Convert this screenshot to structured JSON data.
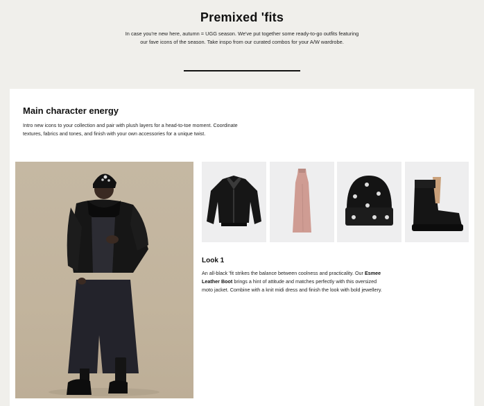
{
  "header": {
    "title": "Premixed 'fits",
    "intro": "In case you're new here, autumn = UGG season. We've put together some ready-to-go outfits featuring our fave icons of the season. Take inspo from our curated combos for your A/W wardrobe."
  },
  "section": {
    "title": "Main character energy",
    "intro": "Intro new icons to your collection and pair with plush layers for a head-to-toe moment. Coordinate textures, fabrics and tones, and finish with your own accessories for a unique twist."
  },
  "products": [
    {
      "icon": "leather-jacket-icon"
    },
    {
      "icon": "pink-dress-icon"
    },
    {
      "icon": "embellished-beanie-icon"
    },
    {
      "icon": "shearling-boot-icon"
    }
  ],
  "look": {
    "title": "Look 1",
    "text_before": "An all-black 'fit strikes the balance between coolness and practicality. Our ",
    "link_text": "Esmee Leather Boot",
    "text_after": " brings a hint of attitude and matches perfectly with this oversized moto jacket. Combine with a knit midi dress and finish the look with bold jewellery."
  },
  "colors": {
    "page_background": "#f0efeb",
    "panel_background": "#ffffff",
    "text": "#111111",
    "photo_background": "#c5b8a3",
    "product_background": "#eeeeef"
  }
}
